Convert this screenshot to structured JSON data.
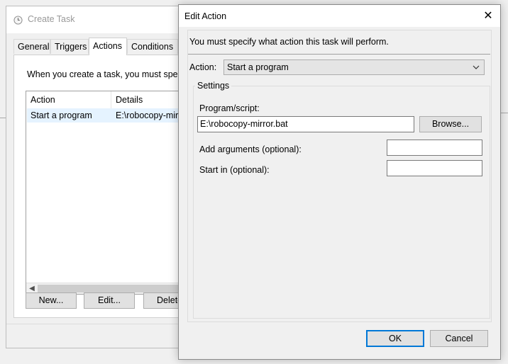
{
  "create_task": {
    "title": "Create Task",
    "tabs": [
      {
        "label": "General"
      },
      {
        "label": "Triggers"
      },
      {
        "label": "Actions"
      },
      {
        "label": "Conditions"
      }
    ],
    "description": "When you create a task, you must specify",
    "table": {
      "columns": [
        "Action",
        "Details"
      ],
      "rows": [
        {
          "action": "Start a program",
          "details": "E:\\robocopy-mirr"
        }
      ]
    },
    "buttons": {
      "new": "New...",
      "edit": "Edit...",
      "delete": "Delete"
    }
  },
  "edit_action": {
    "title": "Edit Action",
    "close_glyph": "✕",
    "intro": "You must specify what action this task will perform.",
    "action_label": "Action:",
    "action_value": "Start a program",
    "settings_legend": "Settings",
    "program_label": "Program/script:",
    "program_value": "E:\\robocopy-mirror.bat",
    "browse": "Browse...",
    "arguments_label": "Add arguments (optional):",
    "arguments_value": "",
    "start_in_label": "Start in (optional):",
    "start_in_value": "",
    "ok": "OK",
    "cancel": "Cancel"
  },
  "icons": {
    "app": "clock-icon",
    "close": "close-icon",
    "dropdown": "chevron-down-icon",
    "scroll_left": "scroll-left-arrow-icon"
  },
  "colors": {
    "accent": "#0078d7",
    "selection": "#e5f3ff",
    "button": "#e1e1e1"
  }
}
